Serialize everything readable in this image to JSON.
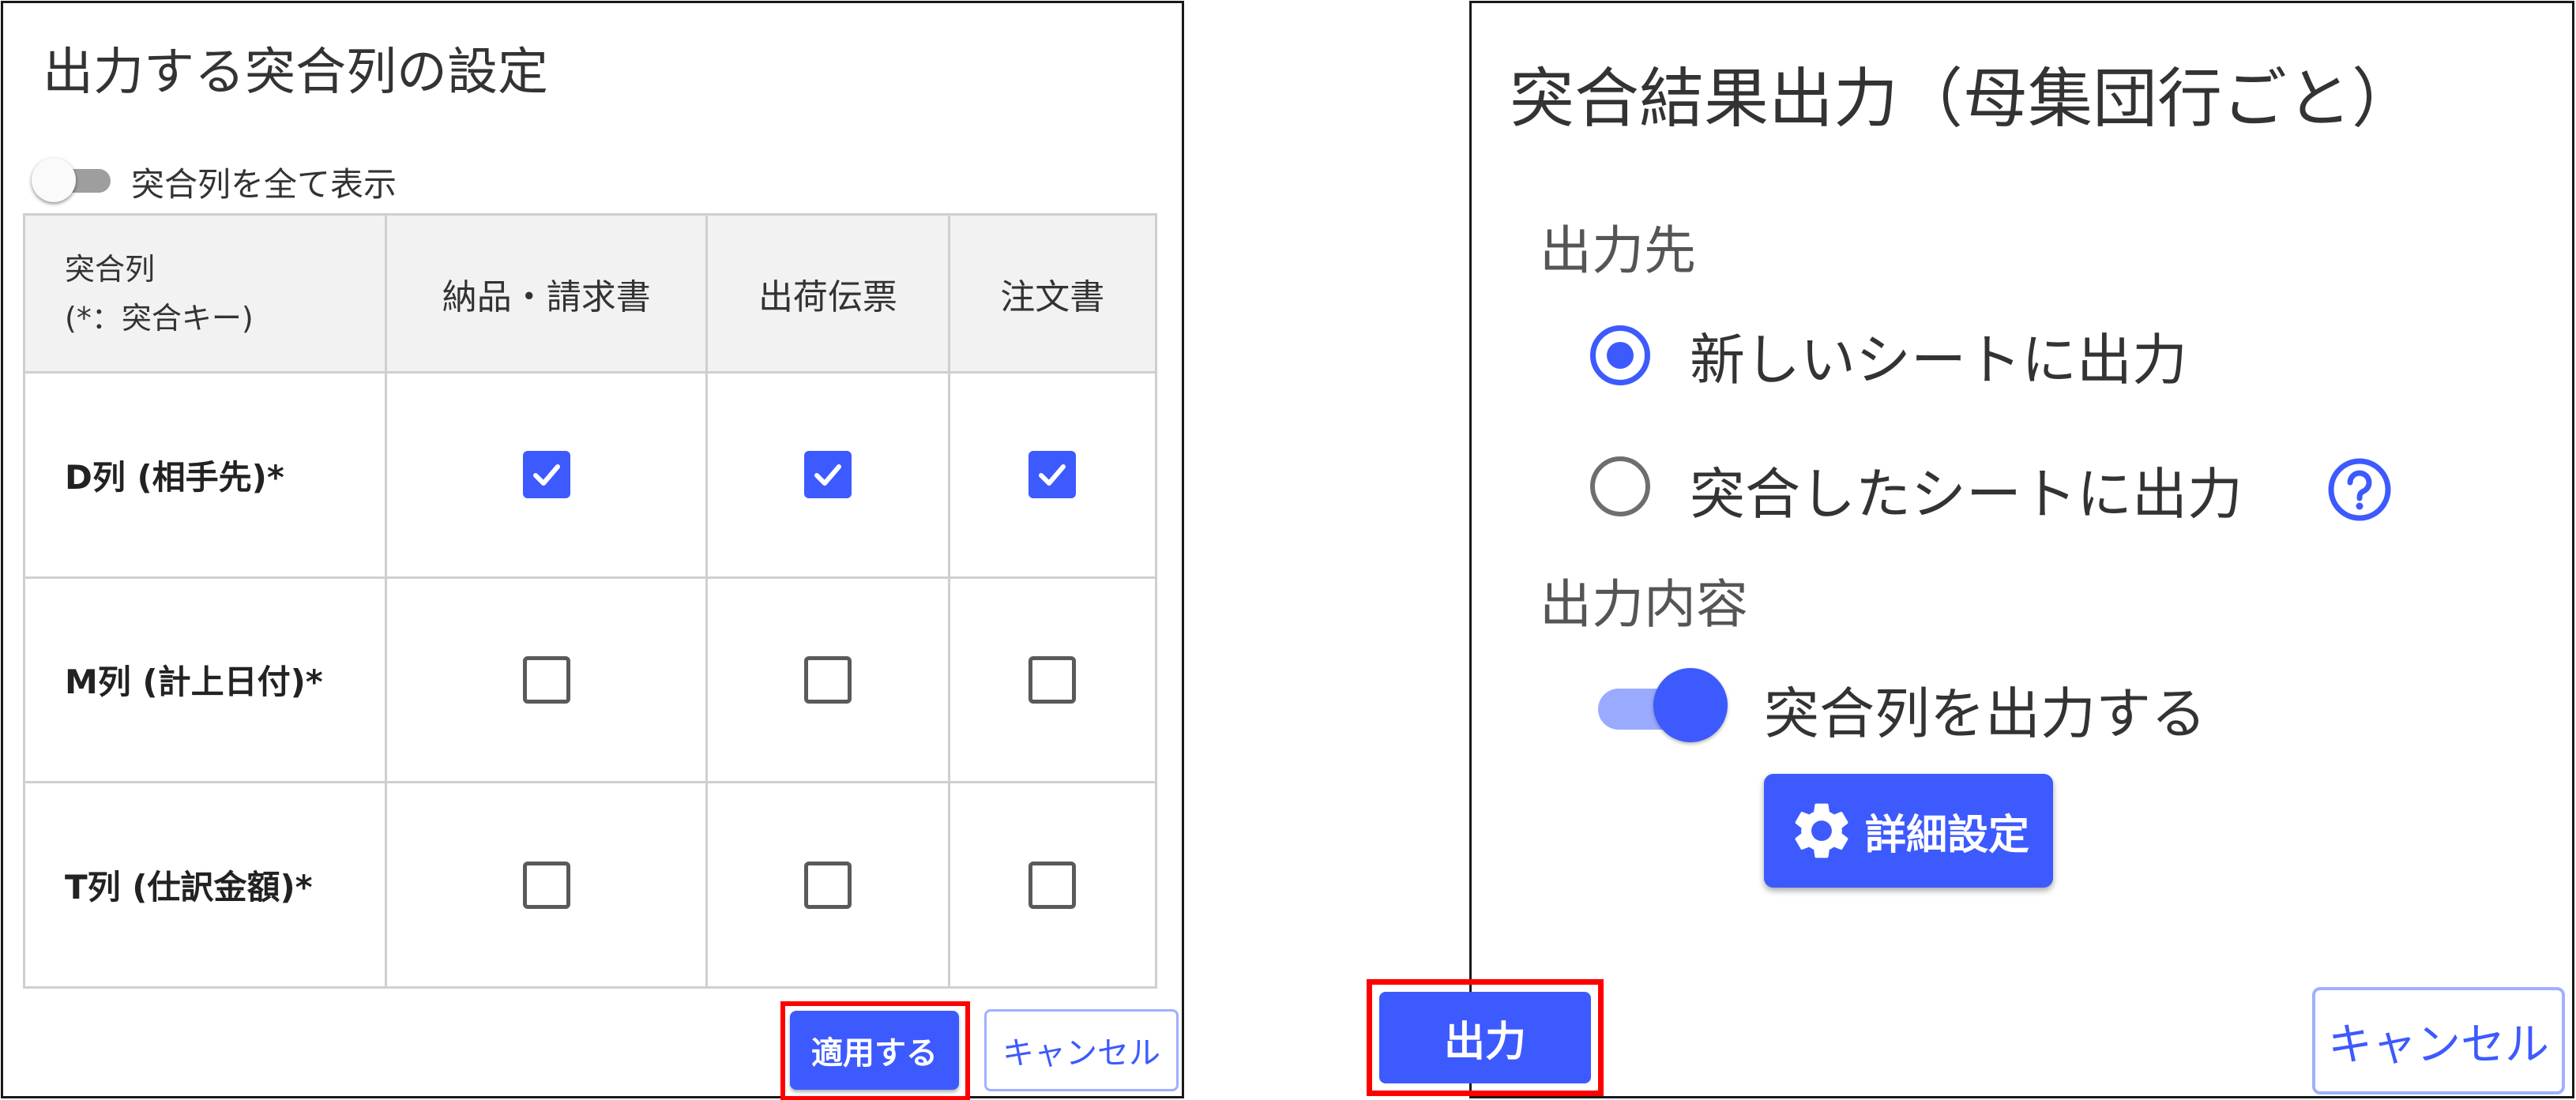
{
  "left_dialog": {
    "title": "出力する突合列の設定",
    "show_all_toggle": {
      "label": "突合列を全て表示",
      "on": false
    },
    "table": {
      "header_first_line1": "突合列",
      "header_first_line2": "(*：突合キー)",
      "columns": [
        "納品・請求書",
        "出荷伝票",
        "注文書"
      ],
      "rows": [
        {
          "label": "D列 (相手先)*",
          "checked": [
            true,
            true,
            true
          ]
        },
        {
          "label": "M列 (計上日付)*",
          "checked": [
            false,
            false,
            false
          ]
        },
        {
          "label": "T列 (仕訳金額)*",
          "checked": [
            false,
            false,
            false
          ]
        }
      ]
    },
    "apply_label": "適用する",
    "cancel_label": "キャンセル"
  },
  "right_dialog": {
    "title": "突合結果出力（母集団行ごと）",
    "destination_heading": "出力先",
    "destination_options": [
      {
        "label": "新しいシートに出力",
        "selected": true
      },
      {
        "label": "突合したシートに出力",
        "selected": false
      }
    ],
    "content_heading": "出力内容",
    "output_columns_toggle": {
      "label": "突合列を出力する",
      "on": true
    },
    "detail_settings_label": "詳細設定",
    "output_label": "出力",
    "cancel_label": "キャンセル"
  },
  "colors": {
    "accent": "#3d5afe",
    "highlight": "#ff0000",
    "border": "#1a1a1a"
  },
  "icons": {
    "checkbox_checked": "check-icon",
    "help": "question-circle-icon",
    "settings": "gear-icon"
  }
}
